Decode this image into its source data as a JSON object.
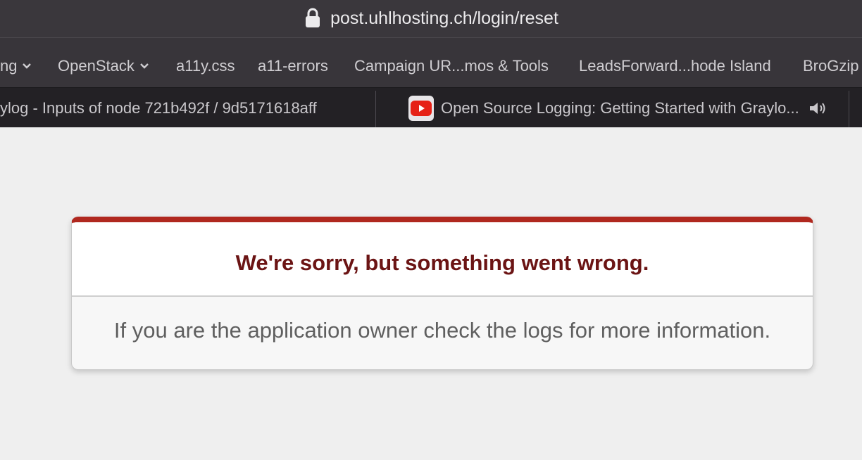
{
  "address_bar": {
    "url": "post.uhlhosting.ch/login/reset",
    "icon": "lock-icon"
  },
  "bookmarks": [
    {
      "label": "ng",
      "folder": true
    },
    {
      "label": "OpenStack",
      "folder": true
    },
    {
      "label": "a11y.css",
      "folder": false
    },
    {
      "label": "a11-errors",
      "folder": false
    },
    {
      "label": "Campaign UR...mos & Tools",
      "folder": false
    },
    {
      "label": "LeadsForward...hode Island",
      "folder": false
    },
    {
      "label": "BroGzip",
      "folder": false
    }
  ],
  "tabs": [
    {
      "title": "ylog - Inputs of node 721b492f / 9d5171618aff"
    },
    {
      "title": "Open Source Logging: Getting Started with Graylo...",
      "icon": "youtube-icon",
      "audio_icon": "speaker-icon"
    }
  ],
  "error": {
    "title": "We're sorry, but something went wrong.",
    "message": "If you are the application owner check the logs for more information.",
    "accent_color": "#b0281f",
    "title_color": "#6b1414"
  }
}
